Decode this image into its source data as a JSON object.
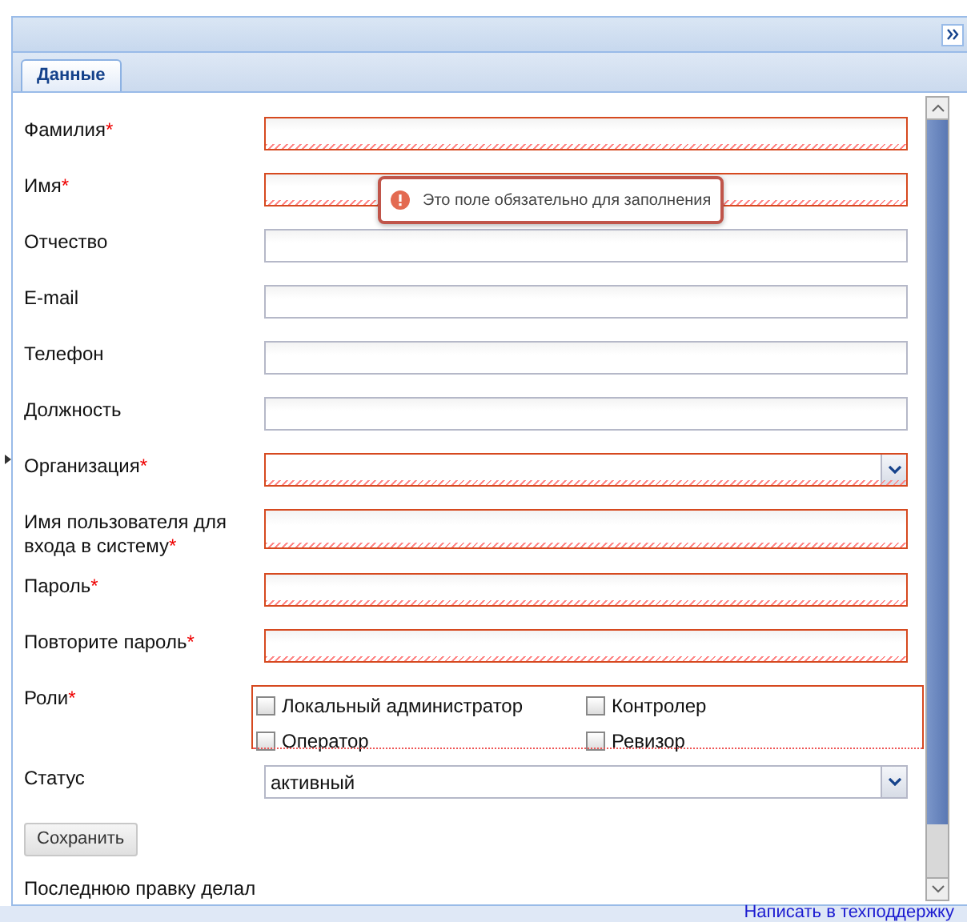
{
  "tab": {
    "label": "Данные",
    "selected": true
  },
  "fields": [
    {
      "kind": "text",
      "label": "Фамилия",
      "required_mark": "*",
      "invalid": true
    },
    {
      "kind": "text",
      "label": "Имя",
      "required_mark": "*",
      "invalid": true
    },
    {
      "kind": "text",
      "label": "Отчество",
      "invalid": false
    },
    {
      "kind": "text",
      "label": "E-mail",
      "invalid": false
    },
    {
      "kind": "text",
      "label": "Телефон",
      "invalid": false
    },
    {
      "kind": "text",
      "label": "Должность",
      "invalid": false
    },
    {
      "kind": "select",
      "label": "Организация",
      "required_mark": "*",
      "invalid": true
    },
    {
      "kind": "text",
      "label": "Имя пользователя для входа в систему",
      "required_mark": "*",
      "invalid": true,
      "tall": true
    },
    {
      "kind": "text",
      "label": "Пароль",
      "required_mark": "*",
      "invalid": true
    },
    {
      "kind": "text",
      "label": "Повторите пароль",
      "required_mark": "*",
      "invalid": true
    },
    {
      "kind": "roles",
      "label": "Роли",
      "required_mark": "*",
      "invalid": true,
      "options": [
        {
          "label": "Локальный администратор",
          "checked": false
        },
        {
          "label": "Контролер",
          "checked": false
        },
        {
          "label": "Оператор",
          "checked": false
        },
        {
          "label": "Ревизор",
          "checked": false
        }
      ]
    },
    {
      "kind": "select",
      "label": "Статус",
      "invalid": false,
      "value": "активный"
    }
  ],
  "tooltip": {
    "text": "Это поле обязательно для заполнения"
  },
  "save_button": "Сохранить",
  "last_edit_label": "Последнюю правку делал",
  "footer_link": "Написать в техподдержку"
}
